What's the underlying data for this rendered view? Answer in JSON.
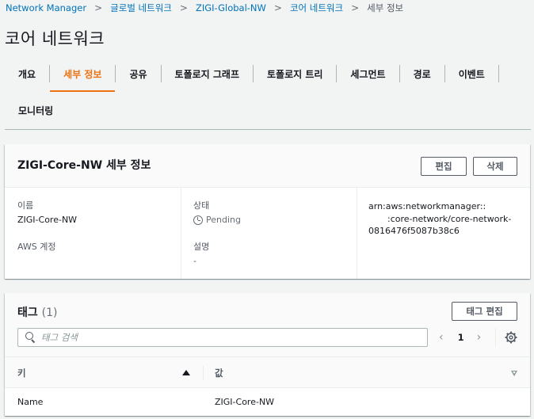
{
  "breadcrumb": {
    "items": [
      "Network Manager",
      "글로벌 네트워크",
      "ZIGI-Global-NW",
      "코어 네트워크"
    ],
    "current": "세부 정보"
  },
  "page_title": "코어 네트워크",
  "tabs": {
    "row1": [
      "개요",
      "세부 정보",
      "공유",
      "토폴로지 그래프",
      "토폴로지 트리",
      "세그먼트",
      "경로",
      "이벤트"
    ],
    "row2": [
      "모니터링"
    ],
    "active": "세부 정보"
  },
  "details": {
    "title": "ZIGI-Core-NW 세부 정보",
    "edit_label": "편집",
    "delete_label": "삭제",
    "name_label": "이름",
    "name_value": "ZIGI-Core-NW",
    "account_label": "AWS 계정",
    "status_label": "상태",
    "status_value": "Pending",
    "description_label": "설명",
    "description_value": "-",
    "arn_line1": "arn:aws:networkmanager::",
    "arn_line2": ":core-network/core-network-",
    "arn_line3": "0816476f5087b38c6"
  },
  "tags": {
    "title": "태그",
    "count": "(1)",
    "edit_label": "태그 편집",
    "search_placeholder": "태그 검색",
    "page": "1",
    "columns": [
      "키",
      "값"
    ],
    "rows": [
      {
        "key": "Name",
        "value": "ZIGI-Core-NW"
      }
    ]
  },
  "icons": [
    "chevron-right-icon",
    "pending-icon",
    "search-icon",
    "chevron-left-icon",
    "gear-icon",
    "sort-asc-icon",
    "sort-desc-icon"
  ],
  "colors": {
    "link": "#0073bb",
    "active_tab": "#ec7211",
    "text": "#16191f",
    "muted": "#687078"
  }
}
